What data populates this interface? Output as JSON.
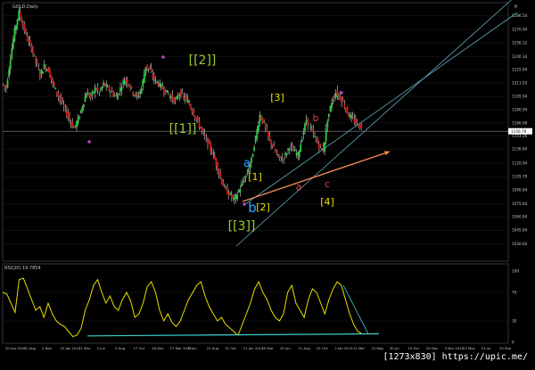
{
  "chart_data": {
    "type": "candlestick",
    "symbol_label": "GOLD,Daily",
    "colors": {
      "background": "#000000",
      "up": "#2ecc40",
      "down": "#d01818",
      "wick": "#ffffff",
      "grid": "#1e1e1e",
      "axis_text": "#c8c8c8",
      "channel": "#5fa7b8",
      "trend_arrow": "#ee8855",
      "rsi_line": "#e8e000",
      "rsi_trend": "#40d0d0",
      "marker": "#c040c0",
      "label_green": "#9acd32",
      "label_yellow": "#e8e000",
      "label_blue": "#33aaff",
      "label_red": "#e04040"
    },
    "price_axis": {
      "ylim": [
        1012,
        1300
      ],
      "ticks": [
        "1286.54",
        "1270.94",
        "1256.12",
        "1240.34",
        "1225.94",
        "1211.03",
        "1195.94",
        "1180.94",
        "1166.09",
        "1151.26",
        "1136.84",
        "1120.94",
        "1105.79",
        "1090.84",
        "1075.64",
        "1060.84",
        "1045.84",
        "1030.64"
      ],
      "tick_values": [
        1286.54,
        1270.94,
        1256.12,
        1240.34,
        1225.94,
        1211.03,
        1195.94,
        1180.94,
        1166.09,
        1151.26,
        1136.84,
        1120.94,
        1105.79,
        1090.84,
        1075.64,
        1060.84,
        1045.84,
        1030.64
      ],
      "current_price": "1156.79",
      "current_value": 1156.79
    },
    "price_series": {
      "name": "GOLD",
      "closes": [
        1210,
        1205,
        1240,
        1270,
        1290,
        1275,
        1260,
        1250,
        1235,
        1220,
        1230,
        1225,
        1210,
        1200,
        1190,
        1180,
        1170,
        1160,
        1170,
        1185,
        1200,
        1195,
        1205,
        1200,
        1210,
        1205,
        1200,
        1195,
        1205,
        1215,
        1210,
        1200,
        1195,
        1205,
        1230,
        1225,
        1215,
        1210,
        1205,
        1200,
        1195,
        1190,
        1200,
        1195,
        1190,
        1180,
        1170,
        1160,
        1150,
        1140,
        1130,
        1115,
        1100,
        1090,
        1085,
        1080,
        1090,
        1100,
        1110,
        1125,
        1150,
        1175,
        1165,
        1150,
        1140,
        1130,
        1125,
        1130,
        1140,
        1135,
        1130,
        1150,
        1170,
        1160,
        1150,
        1140,
        1135,
        1170,
        1190,
        1200,
        1195,
        1185,
        1175,
        1170,
        1165,
        1160
      ],
      "x_start": 3,
      "x_end": 406
    },
    "channel_lines": [
      {
        "x1": 265,
        "y1": 1028,
        "x2": 580,
        "y2": 1310
      },
      {
        "x1": 275,
        "y1": 1075,
        "x2": 580,
        "y2": 1290
      }
    ],
    "trend_arrow": {
      "x1": 272,
      "y1": 1078,
      "x2": 437,
      "y2": 1134
    },
    "markers": [
      {
        "x": 183,
        "y": 1240
      },
      {
        "x": 100,
        "y": 1145
      },
      {
        "x": 383,
        "y": 1200
      },
      {
        "x": 274,
        "y": 1075
      }
    ],
    "wave_labels": [
      {
        "text": "[[2]]",
        "x": 227,
        "y": 1232,
        "color": "label_green",
        "size": 14
      },
      {
        "text": "[[1]]",
        "x": 205,
        "y": 1155,
        "color": "label_green",
        "size": 14
      },
      {
        "text": "[[3]]",
        "x": 271,
        "y": 1046,
        "color": "label_green",
        "size": 14
      },
      {
        "text": "[3]",
        "x": 311,
        "y": 1191,
        "color": "label_yellow",
        "size": 11
      },
      {
        "text": "[1]",
        "x": 286,
        "y": 1102,
        "color": "label_yellow",
        "size": 11
      },
      {
        "text": "[2]",
        "x": 295,
        "y": 1068,
        "color": "label_yellow",
        "size": 11
      },
      {
        "text": "[4]",
        "x": 367,
        "y": 1074,
        "color": "label_yellow",
        "size": 11
      },
      {
        "text": "a",
        "x": 277,
        "y": 1117,
        "color": "label_blue",
        "size": 13
      },
      {
        "text": "b",
        "x": 283,
        "y": 1066,
        "color": "label_blue",
        "size": 15
      },
      {
        "text": "b",
        "x": 354,
        "y": 1168,
        "color": "label_red",
        "size": 11
      },
      {
        "text": "a",
        "x": 335,
        "y": 1091,
        "color": "label_red",
        "size": 11
      },
      {
        "text": "c",
        "x": 367,
        "y": 1094,
        "color": "label_red",
        "size": 11
      }
    ],
    "rsi": {
      "label": "RSI(20) 19.7854",
      "ylim": [
        0,
        100
      ],
      "ticks": [
        "100",
        "70",
        "30",
        "0"
      ],
      "tick_values": [
        100,
        70,
        30,
        0
      ],
      "levels": [
        70,
        30
      ],
      "values": [
        70,
        68,
        55,
        42,
        88,
        90,
        75,
        60,
        45,
        50,
        35,
        55,
        40,
        30,
        25,
        22,
        15,
        8,
        10,
        20,
        45,
        60,
        80,
        88,
        70,
        55,
        65,
        50,
        45,
        60,
        70,
        58,
        35,
        40,
        55,
        78,
        85,
        70,
        45,
        30,
        40,
        28,
        22,
        30,
        45,
        60,
        70,
        80,
        85,
        65,
        50,
        40,
        30,
        35,
        25,
        20,
        15,
        10,
        25,
        40,
        55,
        75,
        85,
        70,
        60,
        45,
        35,
        30,
        40,
        70,
        80,
        55,
        45,
        35,
        60,
        75,
        70,
        55,
        40,
        60,
        75,
        85,
        80,
        60,
        40,
        25,
        15,
        12
      ],
      "trend_line": {
        "x1": 98,
        "y1": 9,
        "x2": 425,
        "y2": 12
      },
      "down_line": {
        "x1": 385,
        "y1": 80,
        "x2": 413,
        "y2": 12
      }
    },
    "date_ticks": [
      "30 Jun 2010",
      "31 Aug",
      "2 Nov",
      "10 Jan 2011",
      "21 Mar",
      "2 Jun",
      "9 Aug",
      "17 Oct",
      "26 Dec",
      "27 Mar 2012",
      "8 Jun",
      "22 Aug",
      "31 Oct",
      "11 Jan 2013",
      "25 Mar",
      "10 Jun",
      "21 Aug",
      "24 Oct",
      "2 Jan 2014",
      "12 Mar",
      "22 May",
      "30 Jul",
      "10 Oct",
      "20 Dec",
      "3 Mar 2015",
      "13 May",
      "23 Jul",
      "29 Sep"
    ]
  },
  "watermark": "[1273x830] https://upic.me/"
}
